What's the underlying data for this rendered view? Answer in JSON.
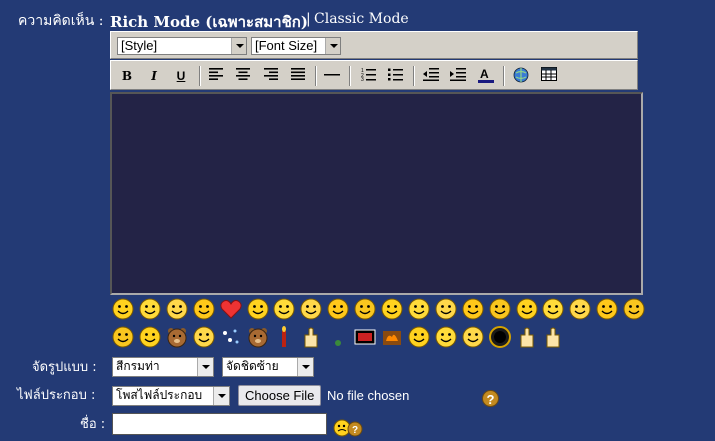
{
  "comment_label": "ความคิดเห็น :",
  "mode": {
    "rich": "Rich Mode (เฉพาะสมาชิก)",
    "separator": "|",
    "classic": "Classic Mode"
  },
  "toolbar": {
    "style_select": "[Style]",
    "fontsize_select": "[Font Size]",
    "bold": "B",
    "italic": "I",
    "underline": "U",
    "buttons": [
      "bold",
      "italic",
      "underline",
      "align-left",
      "align-center",
      "align-right",
      "justify",
      "horizontal-rule",
      "ordered-list",
      "unordered-list",
      "outdent",
      "indent",
      "text-color",
      "insert-link",
      "insert-table"
    ]
  },
  "format": {
    "label": "จัดรูปแบบ :",
    "font_value": "สีกรมท่า",
    "align_value": "จัดชิดซ้าย"
  },
  "attach": {
    "label": "ไฟล์ประกอบ :",
    "type_value": "โพสไฟล์ประกอบ",
    "choose_button": "Choose File",
    "status": "No file chosen"
  },
  "name": {
    "label": "ชื่อ :",
    "value": ""
  },
  "help_icon": "?",
  "colors": {
    "background": "#233a75",
    "editor": "#232346",
    "toolbar": "#d4d0c8"
  },
  "smileys_row1": [
    "confused-icon",
    "tongue-icon",
    "smile-icon",
    "sick-icon",
    "heart-icon",
    "laugh-icon",
    "grin-icon",
    "happy-icon",
    "wink-icon",
    "cool-icon",
    "beam-icon",
    "dance-icon",
    "shocked-icon",
    "cry-icon",
    "sleep-icon",
    "thumbs-icon",
    "sweat-icon",
    "tired-icon",
    "cat-icon",
    "sly-icon"
  ],
  "smileys_row2": [
    "clown-icon",
    "kiss-icon",
    "bear-icon",
    "pig-icon",
    "sparkle-icon",
    "teddy-icon",
    "candle-icon",
    "hand-icon",
    "dot-icon",
    "tv-icon",
    "fire-icon",
    "clap-icon",
    "silly-icon",
    "lol-icon",
    "ring-icon",
    "thumbs-down-icon",
    "thumbs-up-icon"
  ]
}
